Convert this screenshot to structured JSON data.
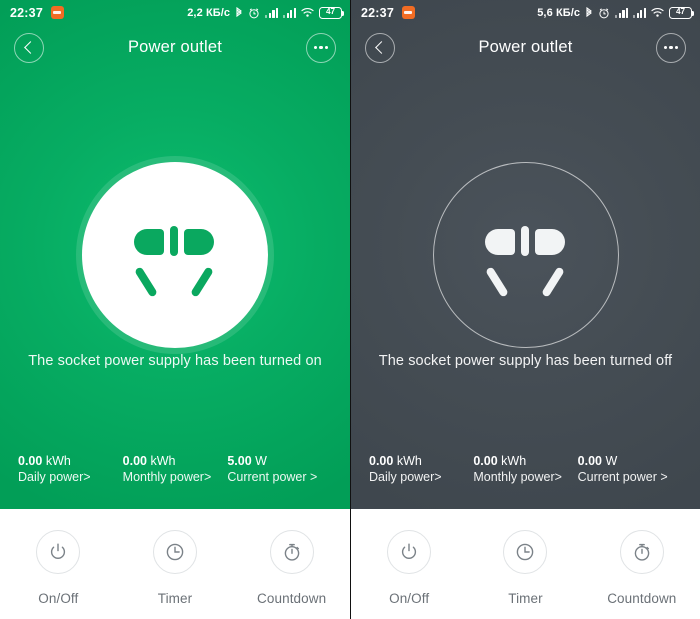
{
  "panels": [
    {
      "id": "on",
      "state": "on",
      "accent_color": "#07ad63",
      "statusbar": {
        "time": "22:37",
        "app_icon": "app-badge-icon",
        "data_rate": "2,2 КБ/c",
        "bluetooth_icon": "bluetooth-icon",
        "alarm_icon": "alarm-clock-icon",
        "signal1_icon": "signal-bars-icon",
        "signal2_icon": "signal-bars-icon",
        "wifi_icon": "wifi-icon",
        "battery_level": "47"
      },
      "header": {
        "back_icon": "back-chevron-icon",
        "title": "Power outlet",
        "menu_icon": "more-options-icon"
      },
      "socket_icon": "power-socket-icon",
      "status_message": "The socket power supply has been turned on",
      "metrics": [
        {
          "value": "0.00",
          "unit": "kWh",
          "label": "Daily power>"
        },
        {
          "value": "0.00",
          "unit": "kWh",
          "label": "Monthly power>"
        },
        {
          "value": "5.00",
          "unit": "W",
          "label": "Current power >"
        }
      ],
      "actions": [
        {
          "icon": "power-icon",
          "label": "On/Off"
        },
        {
          "icon": "clock-icon",
          "label": "Timer"
        },
        {
          "icon": "stopwatch-icon",
          "label": "Countdown"
        }
      ]
    },
    {
      "id": "off",
      "state": "off",
      "accent_color": "#454d54",
      "statusbar": {
        "time": "22:37",
        "app_icon": "app-badge-icon",
        "data_rate": "5,6 КБ/c",
        "bluetooth_icon": "bluetooth-icon",
        "alarm_icon": "alarm-clock-icon",
        "signal1_icon": "signal-bars-icon",
        "signal2_icon": "signal-bars-icon",
        "wifi_icon": "wifi-icon",
        "battery_level": "47"
      },
      "header": {
        "back_icon": "back-chevron-icon",
        "title": "Power outlet",
        "menu_icon": "more-options-icon"
      },
      "socket_icon": "power-socket-icon",
      "status_message": "The socket power supply has been turned off",
      "metrics": [
        {
          "value": "0.00",
          "unit": "kWh",
          "label": "Daily power>"
        },
        {
          "value": "0.00",
          "unit": "kWh",
          "label": "Monthly power>"
        },
        {
          "value": "0.00",
          "unit": "W",
          "label": "Current power >"
        }
      ],
      "actions": [
        {
          "icon": "power-icon",
          "label": "On/Off"
        },
        {
          "icon": "clock-icon",
          "label": "Timer"
        },
        {
          "icon": "stopwatch-icon",
          "label": "Countdown"
        }
      ]
    }
  ]
}
